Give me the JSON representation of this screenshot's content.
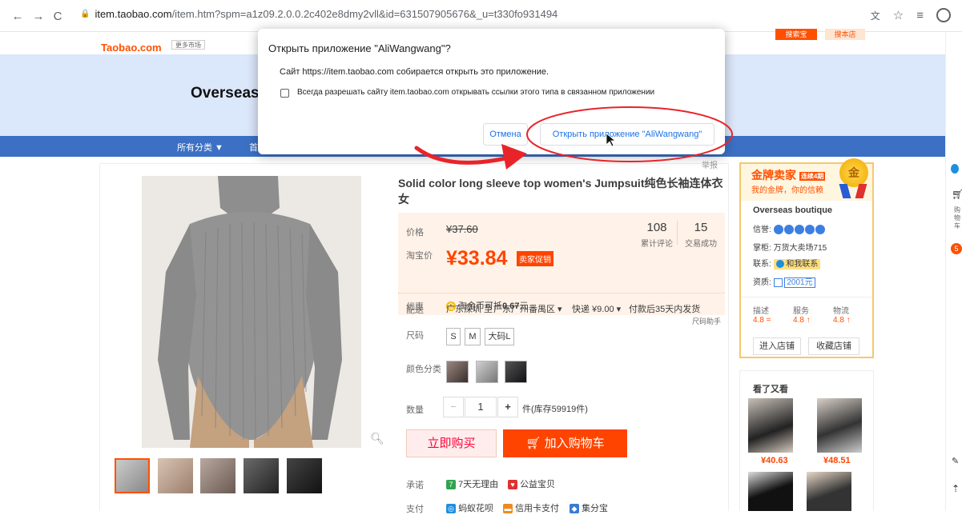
{
  "browser": {
    "url_host": "item.taobao.com",
    "url_path": "/item.htm?spm=a1z09.2.0.0.2c402e8dmy2vll&id=631507905676&_u=t330fo931494"
  },
  "site": {
    "logo_text": "Taobao.com",
    "logo_tag": "更多市场",
    "search_btn_1": "搜索宝",
    "search_btn_2": "搜本店",
    "banner_title": "Overseas",
    "category_menu": "所有分类 ▼",
    "category_home": "首"
  },
  "dialog": {
    "title": "Открыть приложение \"AliWangwang\"?",
    "description": "Сайт https://item.taobao.com собирается открыть это приложение.",
    "checkbox_label": "Всегда разрешать сайту item.taobao.com открывать ссылки этого типа в связанном приложении",
    "cancel": "Отмена",
    "open": "Открыть приложение \"AliWangwang\""
  },
  "product": {
    "report": "举报",
    "title": "Solid color long sleeve top women's Jumpsuit纯色长袖连体衣女",
    "price_label": "价格",
    "original_price": "¥37.60",
    "taobao_price_label": "淘宝价",
    "current_price": "¥33.84",
    "promo_tag": "卖家促销",
    "reviews_count": "108",
    "reviews_label": "累计评论",
    "sales_count": "15",
    "sales_label": "交易成功",
    "discount_label": "优惠",
    "coin_text": "淘金币可抵",
    "coin_value": "0.67",
    "coin_unit": "元",
    "shipping_label": "配送",
    "shipping_from": "广东深圳 至",
    "shipping_to": "广东广州番禺区 ▾",
    "shipping_fee": "快递 ¥9.00 ▾",
    "shipping_time": "付款后35天内发货",
    "size_helper": "尺码助手",
    "size_label": "尺码",
    "sizes": [
      "S",
      "M",
      "大码L"
    ],
    "color_label": "颜色分类",
    "qty_label": "数量",
    "qty_minus": "−",
    "qty_value": "1",
    "qty_plus": "+",
    "stock_text": "件(库存59919件)",
    "buy_now": "立即购买",
    "add_cart": "加入购物车",
    "promise_label": "承诺",
    "promise_1": "7天无理由",
    "promise_2": "公益宝贝",
    "pay_label": "支付",
    "pay_1": "蚂蚁花呗",
    "pay_2": "信用卡支付",
    "pay_3": "集分宝"
  },
  "seller": {
    "level": "金牌卖家",
    "level_tag": "连续4期",
    "slogan": "我的金牌，你的信赖",
    "medal": "金",
    "shop_name": "Overseas boutique",
    "credit_label": "信誉:",
    "owner_label": "掌柜:",
    "owner_name": "万货大卖场715",
    "contact_label": "联系:",
    "contact_btn": "和我联系",
    "qual_label": "资质:",
    "qual_value": "2001元",
    "desc_label": "描述",
    "desc_score": "4.8 =",
    "service_label": "服务",
    "service_score": "4.8 ↑",
    "logistics_label": "物流",
    "logistics_score": "4.8 ↑",
    "enter_shop": "进入店铺",
    "fav_shop": "收藏店铺"
  },
  "also_viewed": {
    "title": "看了又看",
    "items": [
      {
        "price": "¥40.63"
      },
      {
        "price": "¥48.51"
      }
    ]
  },
  "edge": {
    "cart_text": "购物车",
    "cart_count": "5"
  },
  "colors": {
    "brand_orange": "#ff5000",
    "price_red": "#ff4400",
    "banner_blue": "#dbe7fa",
    "catbar_blue": "#3b70c4",
    "dialog_link": "#1a73e8",
    "annotation_red": "#e8242a"
  }
}
